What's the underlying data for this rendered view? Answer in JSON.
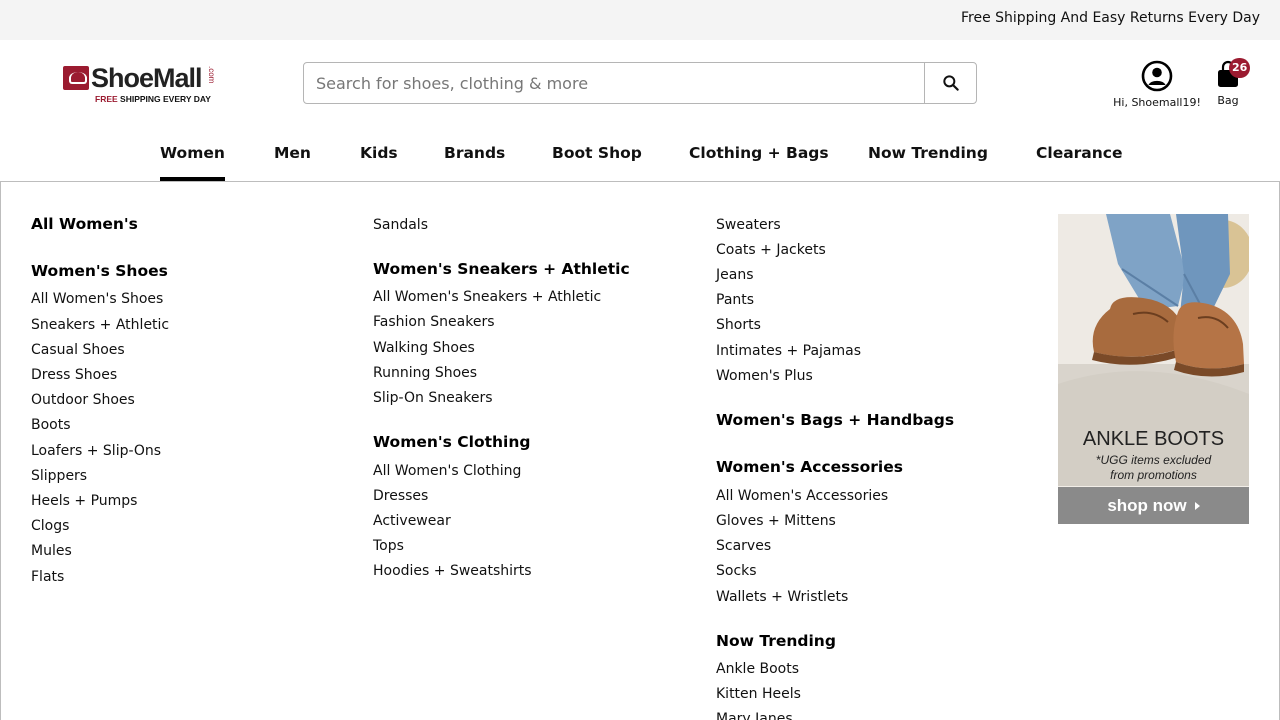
{
  "topbar": {
    "promo": "Free Shipping And Easy Returns Every Day"
  },
  "logo": {
    "name": "ShoeMall",
    "suffix": ".com",
    "tagline_free": "FREE",
    "tagline_rest": " SHIPPING EVERY DAY",
    "icon": "shoemall-logo-mark"
  },
  "search": {
    "placeholder": "Search for shoes, clothing & more",
    "value": "",
    "icon": "search-icon"
  },
  "account": {
    "label": "Hi, Shoemall19!",
    "icon": "account-circle-icon"
  },
  "bag": {
    "label": "Bag",
    "count": "26",
    "icon": "shopping-bag-icon"
  },
  "colors": {
    "brand": "#9b1b30",
    "nav_active": "#000000",
    "promo_button": "#8a8a8a"
  },
  "nav": {
    "items": [
      "Women",
      "Men",
      "Kids",
      "Brands",
      "Boot Shop",
      "Clothing + Bags",
      "Now Trending",
      "Clearance"
    ],
    "active": "Women"
  },
  "menu": {
    "col1": {
      "all": "All Women's",
      "shoes_header": "Women's Shoes",
      "shoes": [
        "All Women's Shoes",
        "Sneakers + Athletic",
        "Casual Shoes",
        "Dress Shoes",
        "Outdoor Shoes",
        "Boots",
        "Loafers + Slip-Ons",
        "Slippers",
        "Heels + Pumps",
        "Clogs",
        "Mules",
        "Flats"
      ]
    },
    "col2": {
      "top": [
        "Sandals"
      ],
      "sneakers_header": "Women's Sneakers + Athletic",
      "sneakers": [
        "All Women's Sneakers + Athletic",
        "Fashion Sneakers",
        "Walking Shoes",
        "Running Shoes",
        "Slip-On Sneakers"
      ],
      "clothing_header": "Women's Clothing",
      "clothing": [
        "All Women's Clothing",
        "Dresses",
        "Activewear",
        "Tops",
        "Hoodies + Sweatshirts"
      ]
    },
    "col3": {
      "top": [
        "Sweaters",
        "Coats + Jackets",
        "Jeans",
        "Pants",
        "Shorts",
        "Intimates + Pajamas",
        "Women's Plus"
      ],
      "bags_header": "Women's Bags + Handbags",
      "accessories_header": "Women's Accessories",
      "accessories": [
        "All Women's Accessories",
        "Gloves + Mittens",
        "Scarves",
        "Socks",
        "Wallets + Wristlets"
      ],
      "trending_header": "Now Trending",
      "trending": [
        "Ankle Boots",
        "Kitten Heels",
        "Mary Janes"
      ]
    }
  },
  "promo": {
    "title": "ANKLE BOOTS",
    "note_line1": "*UGG items excluded",
    "note_line2": "from promotions",
    "button": "shop now"
  }
}
